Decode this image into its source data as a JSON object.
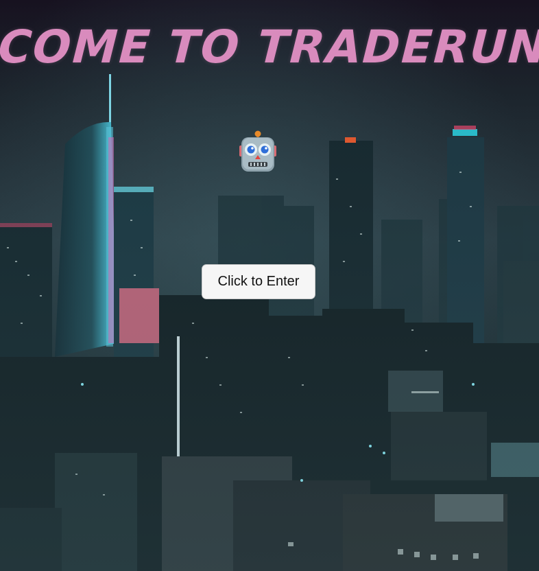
{
  "page": {
    "title": "WELCOME TO TRADERUNNER",
    "title_color": "#d98bbd",
    "mascot_icon": "robot-face-icon",
    "enter_label": "Click to Enter"
  },
  "background": {
    "scene": "night-city-skyline-photo"
  }
}
